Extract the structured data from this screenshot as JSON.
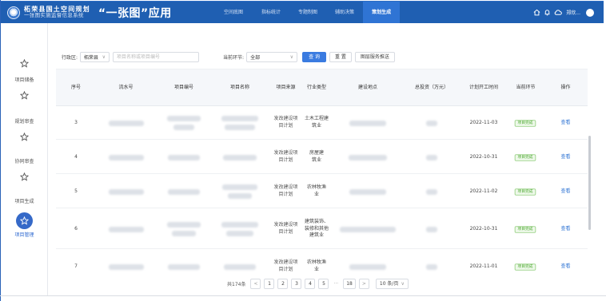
{
  "header": {
    "org_name": "柘荣县国土空间规划",
    "org_sub": "一张图实施监督信息系统",
    "app_title": "“一张图”应用",
    "nav": [
      {
        "label": "空间底图",
        "active": false
      },
      {
        "label": "指标统计",
        "active": false
      },
      {
        "label": "专题制图",
        "active": false
      },
      {
        "label": "辅助决策",
        "active": false
      },
      {
        "label": "策划生成",
        "active": true
      }
    ],
    "user_name": "郑欣...",
    "icons": [
      "home-icon",
      "bell-icon",
      "cloud-icon"
    ]
  },
  "sidebar": {
    "items": [
      {
        "label": "",
        "icon": "star-icon",
        "active": false
      },
      {
        "label": "项目储备",
        "icon": "star-icon",
        "active": false
      },
      {
        "label": "规划审查",
        "icon": "star-icon",
        "active": false
      },
      {
        "label": "协同审查",
        "icon": "star-icon",
        "active": false
      },
      {
        "label": "项目生成",
        "icon": "star-icon",
        "active": false
      },
      {
        "label": "项目管理",
        "icon": "star-icon",
        "active": true
      }
    ]
  },
  "filters": {
    "region_label": "行政区:",
    "region_value": "柘荣县",
    "search_placeholder": "项目名称或项目编号",
    "stage_label": "当前环节:",
    "stage_value": "全部",
    "query_button": "查 询",
    "reset_button": "重 置",
    "push_button": "图层服务推送"
  },
  "table": {
    "columns": [
      "序号",
      "流水号",
      "项目编号",
      "项目名称",
      "项目来源",
      "行业类型",
      "建设地点",
      "总投资（万元）",
      "计划开工时间",
      "当前环节",
      "操作"
    ],
    "rows": [
      {
        "no": "3",
        "source": "发改建设项目计划",
        "industry": "土木工程建筑业",
        "date": "2022-11-03",
        "status": "项目完成",
        "action": "查看"
      },
      {
        "no": "4",
        "source": "发改建设项目计划",
        "industry": "房屋建筑业",
        "date": "2022-10-31",
        "status": "项目完成",
        "action": "查看"
      },
      {
        "no": "5",
        "source": "发改建设项目计划",
        "industry": "农林牧渔业",
        "date": "2022-11-02",
        "status": "项目完成",
        "action": "查看"
      },
      {
        "no": "6",
        "source": "发改建设项目计划",
        "industry": "建筑装饰、装修和其他建筑业",
        "date": "2022-10-31",
        "status": "项目完成",
        "action": "查看"
      },
      {
        "no": "7",
        "source": "发改建设项目计划",
        "industry": "农林牧渔业",
        "date": "2022-11-01",
        "status": "项目完成",
        "action": "查看"
      }
    ]
  },
  "pagination": {
    "total": "共174条",
    "prev": "<",
    "pages": [
      "1",
      "2",
      "3",
      "4",
      "5"
    ],
    "ellipsis": "···",
    "last": "18",
    "next": ">",
    "page_size": "10 条/页"
  },
  "colors": {
    "header_bg": "#1f5fb2",
    "nav_active": "#2f74d4",
    "primary": "#3a7be0",
    "status_green": "#4ca72f",
    "link": "#2f74d4"
  }
}
